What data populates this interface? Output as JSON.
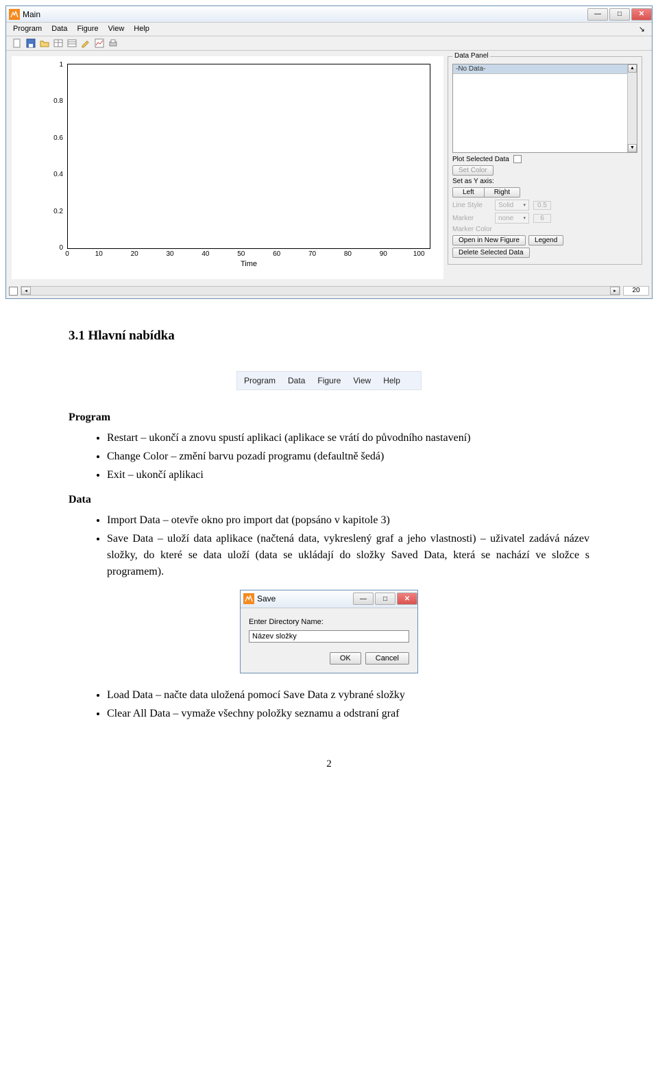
{
  "app": {
    "title": "Main",
    "menubar": [
      "Program",
      "Data",
      "Figure",
      "View",
      "Help"
    ],
    "dataPanel": {
      "legend": "Data Panel",
      "noData": "-No Data-",
      "plotSelected": "Plot Selected Data",
      "setColor": "Set Color",
      "setAsY": "Set as Y axis:",
      "left": "Left",
      "right": "Right",
      "lineStyle": "Line Style",
      "lineStyleVal": "Solid",
      "lineWidthVal": "0.5",
      "marker": "Marker",
      "markerVal": "none",
      "markerSizeVal": "6",
      "markerColor": "Marker Color",
      "openNewFig": "Open in New Figure",
      "legendBtn": "Legend",
      "deleteSel": "Delete Selected Data"
    },
    "plot": {
      "xLabel": "Time",
      "xTicks": [
        "0",
        "10",
        "20",
        "30",
        "40",
        "50",
        "60",
        "70",
        "80",
        "90",
        "100"
      ],
      "yTicks": [
        "1",
        "0.8",
        "0.6",
        "0.4",
        "0.2",
        "0"
      ]
    },
    "footer": {
      "zoom": "20"
    }
  },
  "doc": {
    "heading": "3.1  Hlavní nabídka",
    "menuStrip": [
      "Program",
      "Data",
      "Figure",
      "View",
      "Help"
    ],
    "programLabel": "Program",
    "programItems": [
      "Restart – ukončí a znovu spustí aplikaci (aplikace se vrátí do původního nastavení)",
      "Change Color – změní barvu pozadí programu (defaultně šedá)",
      "Exit – ukončí aplikaci"
    ],
    "dataLabel": "Data",
    "dataItems1": [
      "Import Data – otevře okno pro import dat (popsáno v kapitole 3)",
      "Save Data – uloží data aplikace (načtená data, vykreslený graf a jeho vlastnosti) – uživatel zadává název složky, do které se data uloží (data se ukládají do složky Saved Data, která se nachází ve složce s programem)."
    ],
    "dataItems2": [
      "Load Data – načte data uložená pomocí Save Data z vybrané složky",
      "Clear All Data – vymaže všechny položky seznamu a odstraní graf"
    ],
    "saveDialog": {
      "title": "Save",
      "fieldLabel": "Enter Directory Name:",
      "fieldValue": "Název složky",
      "ok": "OK",
      "cancel": "Cancel"
    },
    "pageNum": "2"
  }
}
